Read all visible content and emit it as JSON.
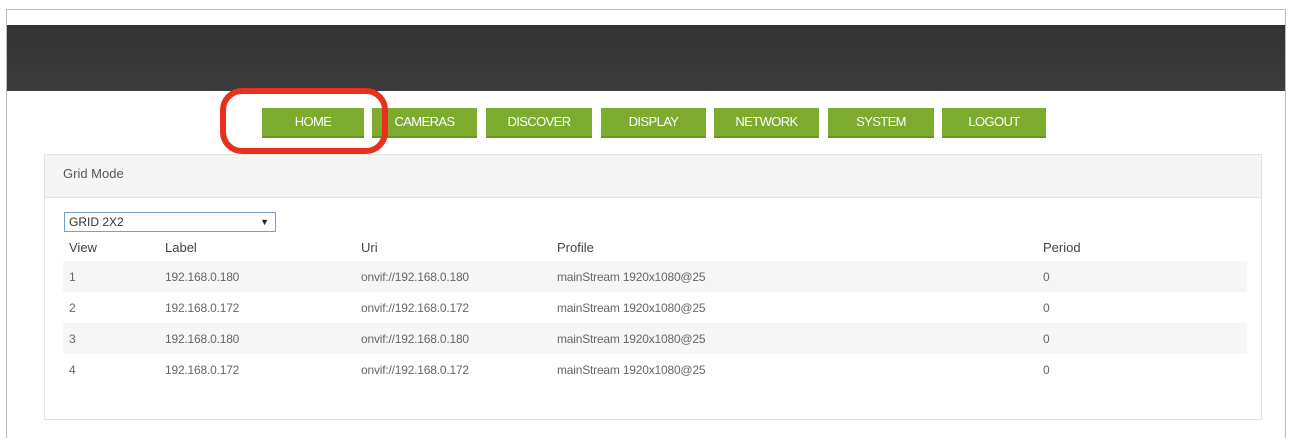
{
  "nav": {
    "items": [
      {
        "label": "HOME",
        "highlighted": true
      },
      {
        "label": "CAMERAS"
      },
      {
        "label": "DISCOVER"
      },
      {
        "label": "DISPLAY"
      },
      {
        "label": "NETWORK"
      },
      {
        "label": "SYSTEM"
      },
      {
        "label": "LOGOUT"
      }
    ]
  },
  "panel": {
    "title": "Grid Mode",
    "grid_select": {
      "value": "GRID 2X2"
    }
  },
  "table": {
    "headers": [
      "View",
      "Label",
      "Uri",
      "Profile",
      "Period"
    ],
    "rows": [
      [
        "1",
        "192.168.0.180",
        "onvif://192.168.0.180",
        "mainStream 1920x1080@25",
        "0"
      ],
      [
        "2",
        "192.168.0.172",
        "onvif://192.168.0.172",
        "mainStream 1920x1080@25",
        "0"
      ],
      [
        "3",
        "192.168.0.180",
        "onvif://192.168.0.180",
        "mainStream 1920x1080@25",
        "0"
      ],
      [
        "4",
        "192.168.0.172",
        "onvif://192.168.0.172",
        "mainStream 1920x1080@25",
        "0"
      ]
    ]
  },
  "colors": {
    "accent": "#7cab2d",
    "header_bar": "#353535",
    "annotation": "#e8301d"
  }
}
